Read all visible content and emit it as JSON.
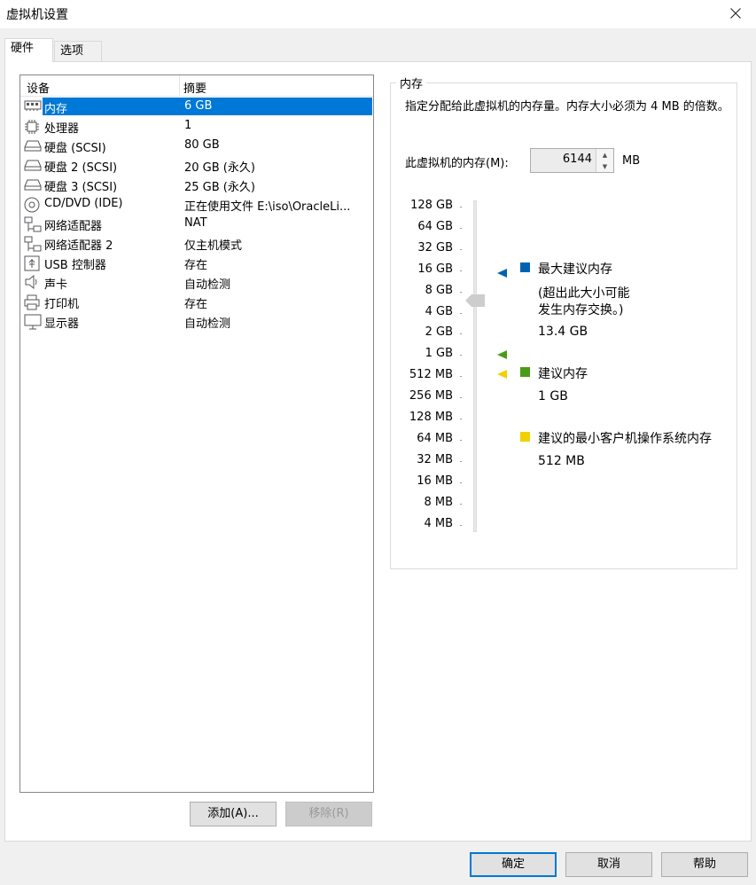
{
  "window": {
    "title": "虚拟机设置"
  },
  "tabs": [
    {
      "label": "硬件"
    },
    {
      "label": "选项"
    }
  ],
  "device_list": {
    "columns": [
      "设备",
      "摘要"
    ],
    "rows": [
      {
        "icon": "memory-icon",
        "name": "内存",
        "value": "6 GB",
        "selected": true
      },
      {
        "icon": "cpu-icon",
        "name": "处理器",
        "value": "1"
      },
      {
        "icon": "disk-icon",
        "name": "硬盘 (SCSI)",
        "value": "80 GB"
      },
      {
        "icon": "disk-icon",
        "name": "硬盘 2 (SCSI)",
        "value": "20 GB (永久)"
      },
      {
        "icon": "disk-icon",
        "name": "硬盘 3 (SCSI)",
        "value": "25 GB (永久)"
      },
      {
        "icon": "cd-icon",
        "name": "CD/DVD (IDE)",
        "value": "正在使用文件 E:\\iso\\OracleLi..."
      },
      {
        "icon": "network-icon",
        "name": "网络适配器",
        "value": "NAT"
      },
      {
        "icon": "network-icon",
        "name": "网络适配器 2",
        "value": "仅主机模式"
      },
      {
        "icon": "usb-icon",
        "name": "USB 控制器",
        "value": "存在"
      },
      {
        "icon": "speaker-icon",
        "name": "声卡",
        "value": "自动检测"
      },
      {
        "icon": "printer-icon",
        "name": "打印机",
        "value": "存在"
      },
      {
        "icon": "monitor-icon",
        "name": "显示器",
        "value": "自动检测"
      }
    ]
  },
  "device_buttons": {
    "add": "添加(A)...",
    "remove": "移除(R)"
  },
  "memory": {
    "group_title": "内存",
    "description": "指定分配给此虚拟机的内存量。内存大小必须为 4 MB 的倍数。",
    "field_label": "此虚拟机的内存(M):",
    "value": "6144",
    "unit": "MB",
    "scale_labels": [
      "128 GB",
      "64 GB",
      "32 GB",
      "16 GB",
      "8 GB",
      "4 GB",
      "2 GB",
      "1 GB",
      "512 MB",
      "256 MB",
      "128 MB",
      "64 MB",
      "32 MB",
      "16 MB",
      "8 MB",
      "4 MB"
    ],
    "max_recommended": {
      "label": "最大建议内存",
      "note_line1": "(超出此大小可能",
      "note_line2": "发生内存交换。)",
      "value": "13.4 GB",
      "color": "#0063b1"
    },
    "recommended": {
      "label": "建议内存",
      "value": "1 GB",
      "color": "#4b9a1a"
    },
    "min_guest": {
      "label": "建议的最小客户机操作系统内存",
      "value": "512 MB",
      "color": "#f2d100"
    }
  },
  "footer": {
    "ok": "确定",
    "cancel": "取消",
    "help": "帮助"
  }
}
